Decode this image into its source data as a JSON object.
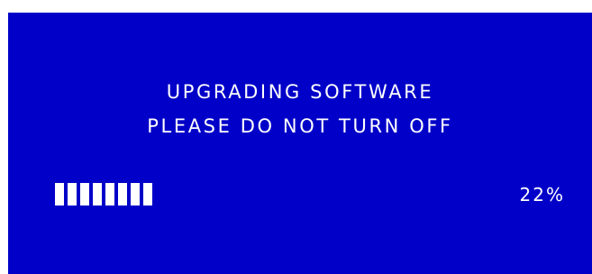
{
  "screen": {
    "line1": "UPGRADING SOFTWARE",
    "line2": "PLEASE DO NOT TURN OFF",
    "progress": {
      "percent_label": "22%",
      "fraction": 0.22,
      "filled_segments": 8
    },
    "colors": {
      "background": "#0000c8",
      "foreground": "#ffffff"
    }
  }
}
